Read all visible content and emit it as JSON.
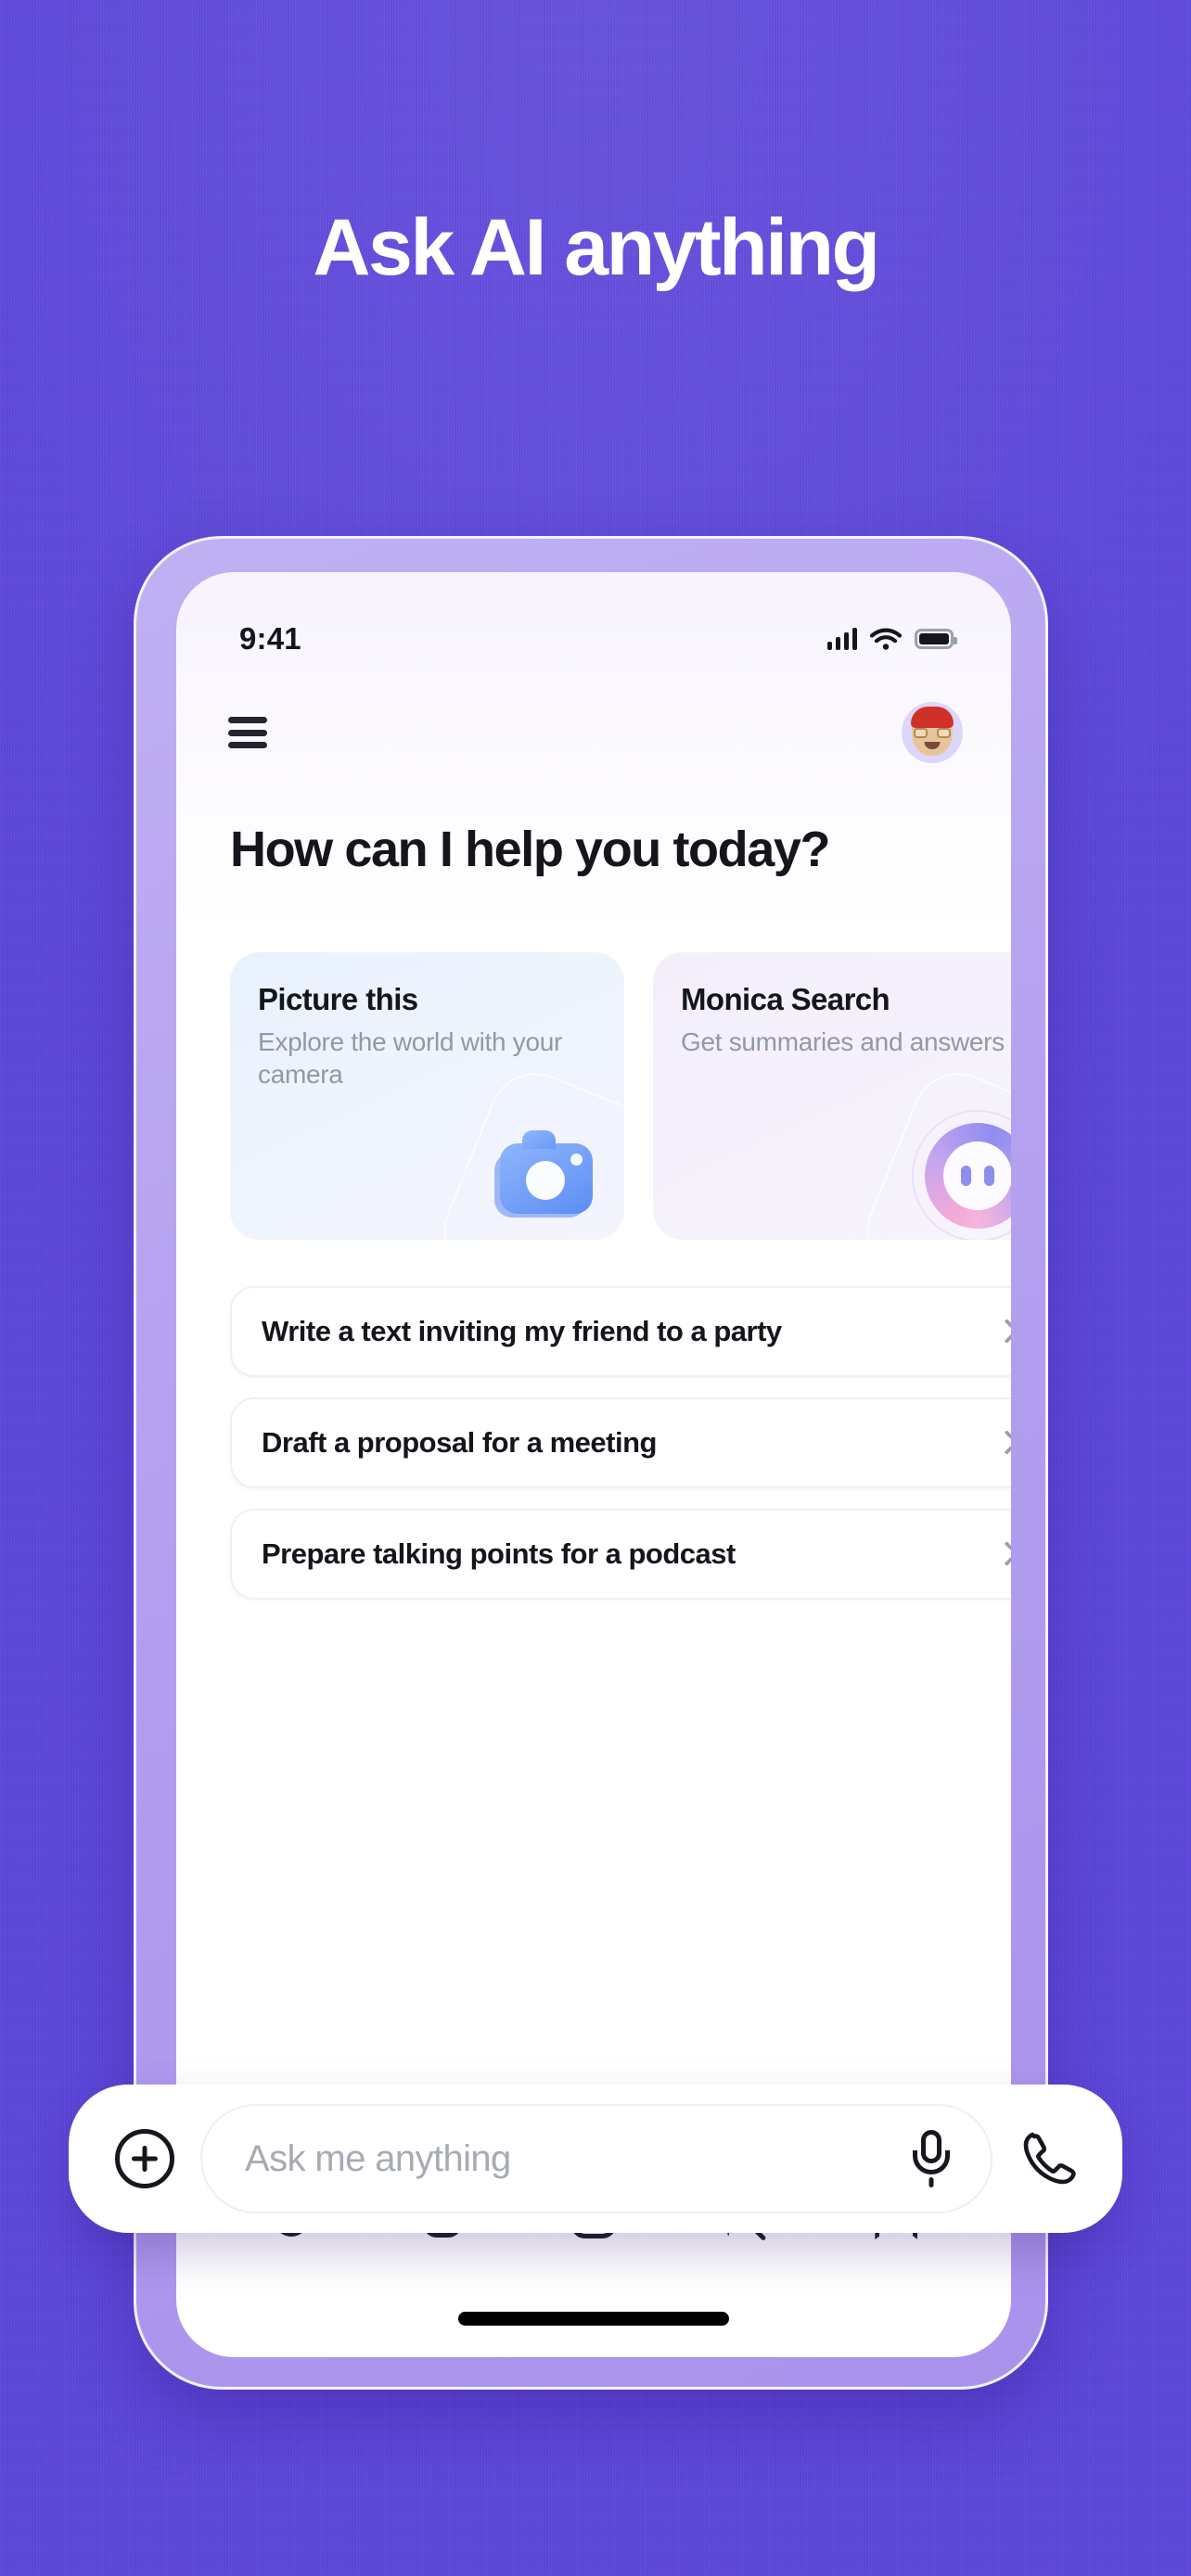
{
  "theme": {
    "backdrop": "#5b44dd",
    "device_bezel": "#b3a0ef",
    "accent_blue": "#5c8df4",
    "ink": "#14161c"
  },
  "hero": {
    "headline": "Ask AI anything"
  },
  "status_bar": {
    "time": "9:41",
    "icons": [
      "cellular-signal-icon",
      "wifi-icon",
      "battery-icon"
    ]
  },
  "app_header": {
    "menu_icon": "hamburger-menu-icon",
    "avatar_label": "avatar"
  },
  "main": {
    "greeting": "How can I help you today?",
    "cards": [
      {
        "title": "Picture this",
        "subtitle": "Explore the world with your camera",
        "icon": "camera-icon",
        "style": "blue"
      },
      {
        "title": "Monica Search",
        "subtitle": "Get summaries and answers",
        "icon": "monica-ring-icon",
        "style": "violet"
      }
    ],
    "suggestions": [
      "Write a text inviting my friend to a party",
      "Draft a proposal for a meeting",
      "Prepare talking points for a podcast"
    ]
  },
  "composer": {
    "add_icon": "plus-circle-icon",
    "placeholder": "Ask me anything",
    "value": "",
    "mic_icon": "microphone-icon",
    "call_icon": "phone-call-icon"
  },
  "bottom_nav": {
    "items": [
      {
        "name": "monica-face-icon",
        "active": true
      },
      {
        "name": "bot-icon",
        "active": false
      },
      {
        "name": "plus-box-icon",
        "active": false
      },
      {
        "name": "search-sparkle-icon",
        "active": false
      },
      {
        "name": "bookmark-sparkle-icon",
        "active": false
      }
    ]
  }
}
